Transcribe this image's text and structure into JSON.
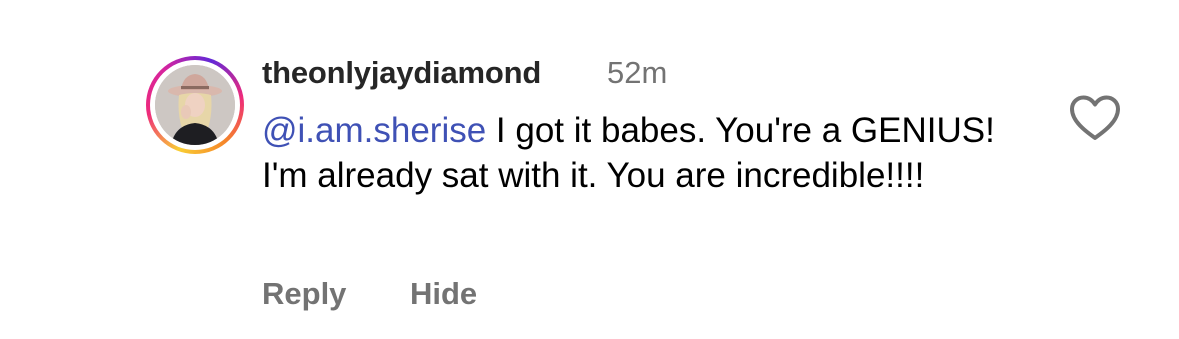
{
  "comment": {
    "author": {
      "username": "theonlyjaydiamond",
      "timestamp": "52m",
      "avatar_icon": "user-avatar-photo"
    },
    "mention": "@i.am.sherise",
    "text": " I got it babes. You're a GENIUS! I'm already sat with it. You are incredible!!!!",
    "like_icon": "heart-outline-icon",
    "actions": {
      "reply_label": "Reply",
      "hide_label": "Hide"
    }
  },
  "colors": {
    "username": "#262626",
    "secondary_text": "#737373",
    "mention_link": "#3f51b5",
    "story_ring_gradient": [
      "#f9ce34",
      "#ee2a7b",
      "#6228d7"
    ]
  }
}
